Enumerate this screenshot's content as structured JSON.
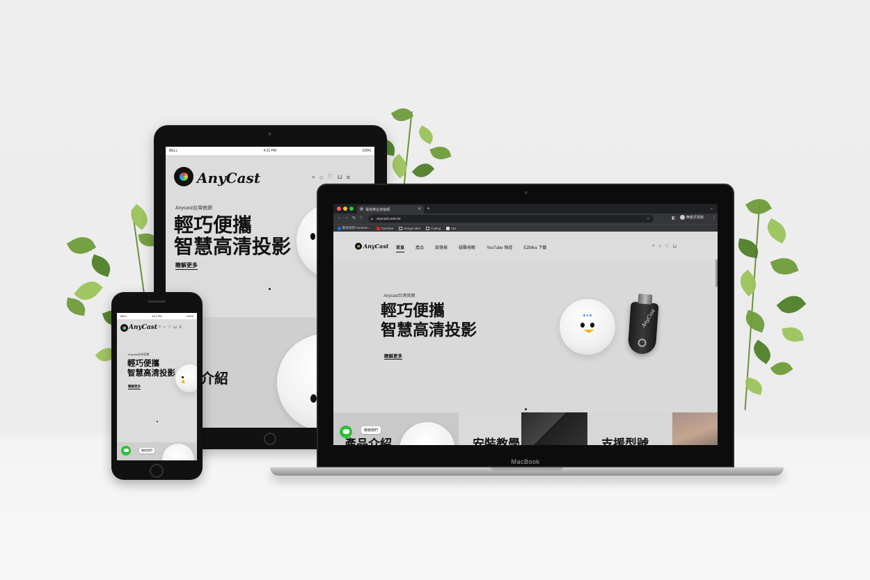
{
  "brand": "AnyCast",
  "laptop_brand": "MacBook",
  "status": {
    "carrier": "BELL",
    "time": "4:21 PM",
    "battery": "100%"
  },
  "site": {
    "kicker": "Anycast台灣官網",
    "title_line1": "輕巧便攜",
    "title_line2": "智慧高清投影",
    "cta": "瞭解更多",
    "contact": "聯絡我們",
    "tablet_section": "介紹",
    "menu": [
      "首頁",
      "產品",
      "部落格",
      "疑難排解",
      "YouTube 頻道",
      "EZMira 下載"
    ],
    "tiles": [
      "產品介紹",
      "安裝教學",
      "支援型號"
    ]
  },
  "browser": {
    "tab_title": "電視棒台灣官網",
    "url": "anycast.com.tw",
    "profile": "無痕式視窗",
    "bookmarks": [
      "歡迎來到 Faceboo...",
      "YouTube",
      "Design idea",
      "Coding",
      "nas"
    ]
  },
  "icons": [
    "search-icon",
    "user-icon",
    "heart-icon",
    "cart-icon",
    "menu-icon",
    "line-chat-icon"
  ],
  "colors": {
    "line_green": "#2fbf39",
    "screen_bg": "#d9d9d9",
    "led_blue": "#4a8fe0"
  }
}
